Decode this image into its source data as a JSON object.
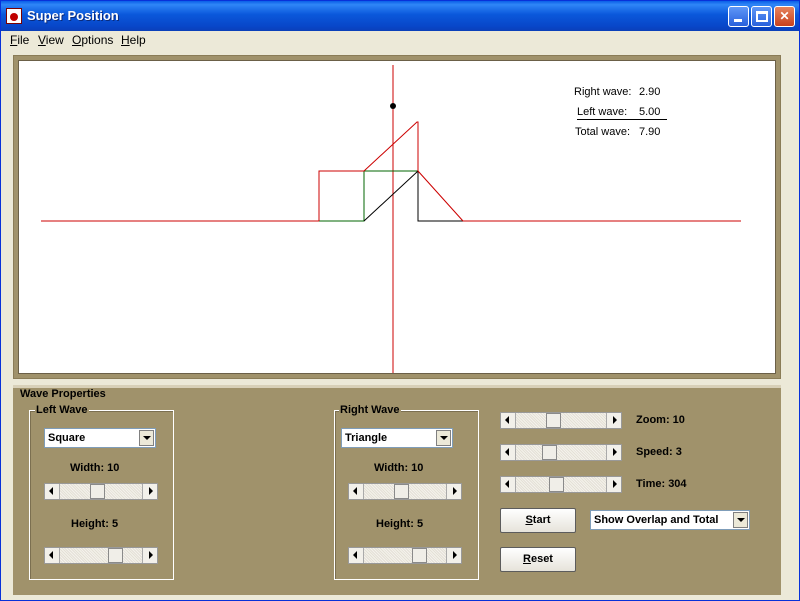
{
  "window": {
    "title": "Super Position"
  },
  "menu": [
    {
      "label": "File",
      "mnemonic": "F",
      "rest": "ile"
    },
    {
      "label": "View",
      "mnemonic": "V",
      "rest": "iew"
    },
    {
      "label": "Options",
      "mnemonic": "O",
      "rest": "ptions"
    },
    {
      "label": "Help",
      "mnemonic": "H",
      "rest": "elp"
    }
  ],
  "readouts": {
    "right": {
      "label": "Right wave:",
      "value": "2.90"
    },
    "left": {
      "label": "Left wave:",
      "value": "5.00"
    },
    "total": {
      "label": "Total wave:",
      "value": "7.90"
    }
  },
  "panel": {
    "title": "Wave Properties",
    "left_wave": {
      "title": "Left Wave",
      "shape": "Square",
      "width_label": "Width: 10",
      "height_label": "Height: 5",
      "width_level": 0.45,
      "height_level": 0.72
    },
    "right_wave": {
      "title": "Right Wave",
      "shape": "Triangle",
      "width_label": "Width: 10",
      "height_label": "Height: 5",
      "width_level": 0.45,
      "height_level": 0.72
    },
    "zoom_label": "Zoom: 10",
    "speed_label": "Speed: 3",
    "time_label": "Time: 304",
    "zoom_level": 0.4,
    "speed_level": 0.34,
    "time_level": 0.44,
    "start_button": {
      "mnemonic": "S",
      "rest": "tart"
    },
    "reset_button": {
      "mnemonic": "R",
      "rest": "eset"
    },
    "display_mode": "Show Overlap and Total"
  },
  "colors": {
    "total_wave": "#cc0000",
    "component_wave": "#006600",
    "marker": "#000000",
    "panel_bg": "#A0926B"
  }
}
